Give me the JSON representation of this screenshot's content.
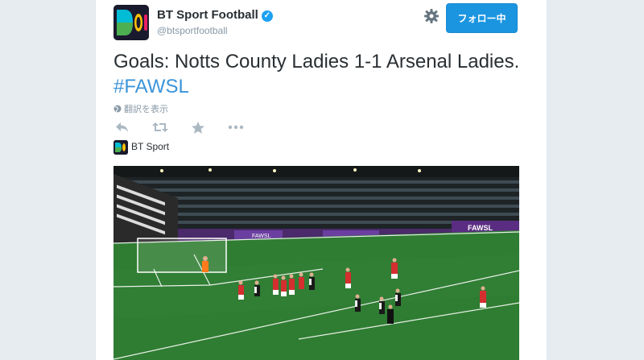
{
  "account": {
    "display_name": "BT Sport Football",
    "verified_icon": "verified-badge-icon",
    "handle": "@btsportfootball"
  },
  "header": {
    "follow_label": "フォロー中",
    "settings_icon": "gear-icon"
  },
  "tweet": {
    "text": "Goals: Notts County Ladies 1-1 Arsenal Ladies.",
    "hashtag": "#FAWSL",
    "translate_label": "翻訳を表示"
  },
  "actions": [
    "reply-icon",
    "retweet-icon",
    "favorite-icon",
    "more-icon"
  ],
  "source": {
    "label": "BT Sport"
  },
  "video": {
    "stadium_ads": [
      "FAWSL",
      "FAWSL"
    ]
  },
  "colors": {
    "accent": "#1b95e0",
    "hashtag": "#3b94d9",
    "muted": "#8899a6",
    "text": "#292f33",
    "pitch": "#2f7d32",
    "arsenal_red": "#d32f2f"
  }
}
